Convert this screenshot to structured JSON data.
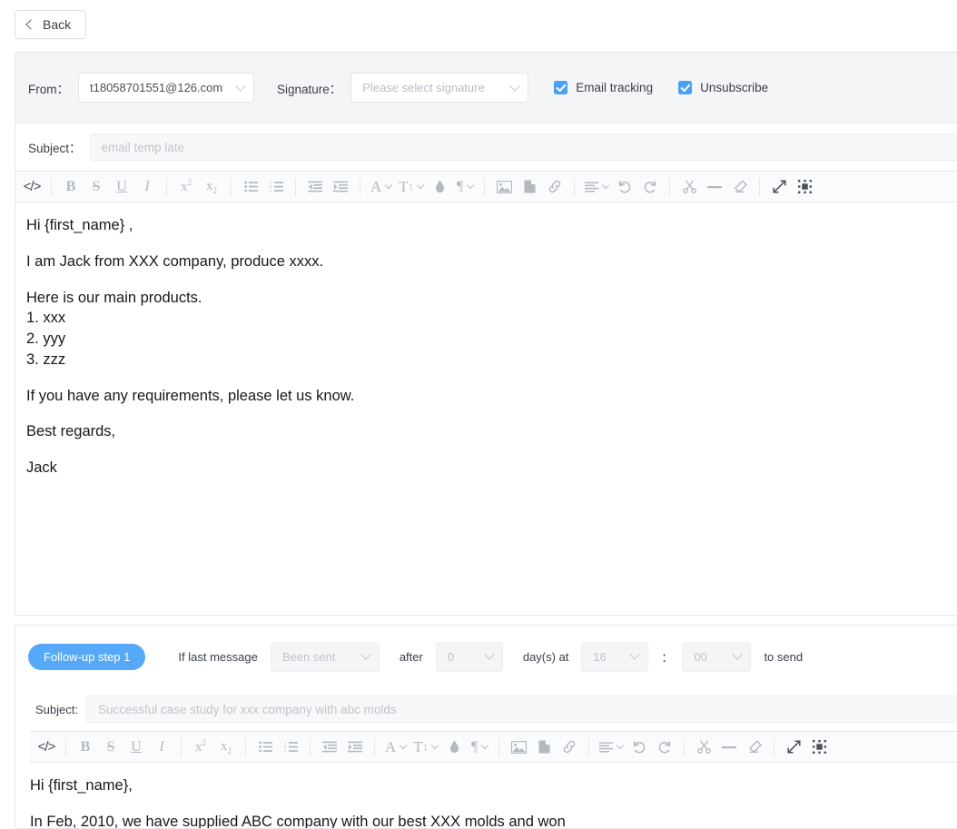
{
  "topbar": {
    "back_label": "Back",
    "back_icon": "chevron-left-icon"
  },
  "compose": {
    "from_label": "From：",
    "from_value": "t18058701551@126.com",
    "signature_label": "Signature：",
    "signature_value": "Please select signature",
    "email_tracking_label": "Email tracking",
    "email_tracking_checked": true,
    "unsubscribe_label": "Unsubscribe",
    "unsubscribe_checked": true,
    "subject_label": "Subject：",
    "subject_value": "",
    "subject_placeholder": "email temp late"
  },
  "toolbar": {
    "items": [
      {
        "name": "source-code-icon",
        "glyph": "</>",
        "kind": "code",
        "dark": true
      },
      {
        "name": "bold-icon",
        "glyph": "B",
        "kind": "bold"
      },
      {
        "name": "strikethrough-icon",
        "glyph": "S",
        "kind": "strike"
      },
      {
        "name": "underline-icon",
        "glyph": "U",
        "kind": "underline"
      },
      {
        "name": "italic-icon",
        "glyph": "I",
        "kind": "italic"
      },
      {
        "name": "superscript-icon",
        "glyph": "x2",
        "kind": "sup"
      },
      {
        "name": "subscript-icon",
        "glyph": "x2",
        "kind": "sub"
      },
      {
        "name": "bullet-list-icon",
        "glyph": "",
        "kind": "ul"
      },
      {
        "name": "numbered-list-icon",
        "glyph": "",
        "kind": "ol"
      },
      {
        "name": "outdent-icon",
        "glyph": "",
        "kind": "outdent"
      },
      {
        "name": "indent-icon",
        "glyph": "",
        "kind": "indent"
      },
      {
        "name": "font-color-icon",
        "glyph": "A",
        "kind": "fontcolor"
      },
      {
        "name": "font-size-icon",
        "glyph": "TI",
        "kind": "fontsize"
      },
      {
        "name": "background-color-icon",
        "glyph": "",
        "kind": "droplet"
      },
      {
        "name": "paragraph-format-icon",
        "glyph": "¶",
        "kind": "para"
      },
      {
        "name": "insert-image-icon",
        "glyph": "",
        "kind": "image"
      },
      {
        "name": "insert-file-icon",
        "glyph": "",
        "kind": "file"
      },
      {
        "name": "insert-link-icon",
        "glyph": "",
        "kind": "link"
      },
      {
        "name": "align-icon",
        "glyph": "",
        "kind": "align"
      },
      {
        "name": "undo-icon",
        "glyph": "",
        "kind": "undo"
      },
      {
        "name": "redo-icon",
        "glyph": "",
        "kind": "redo"
      },
      {
        "name": "cut-icon",
        "glyph": "",
        "kind": "cut"
      },
      {
        "name": "horizontal-rule-icon",
        "glyph": "",
        "kind": "hr"
      },
      {
        "name": "clear-formatting-icon",
        "glyph": "",
        "kind": "eraser"
      },
      {
        "name": "fullscreen-icon",
        "glyph": "",
        "kind": "fullscreen",
        "dark": true
      },
      {
        "name": "select-all-icon",
        "glyph": "",
        "kind": "selectall",
        "dark": true
      }
    ]
  },
  "body": {
    "greeting": "Hi {first_name} ,",
    "intro": "I am Jack from XXX company, produce xxxx.",
    "products_heading": "Here is our main products.",
    "products": [
      "1. xxx",
      "2. yyy",
      "3. zzz"
    ],
    "closing_request": "If you have any requirements, please let us know.",
    "signoff": "Best regards,",
    "sender": "Jack"
  },
  "followup": {
    "step_label": "Follow-up step 1",
    "condition_label": "If last message",
    "condition_value": "",
    "condition_placeholder": "Been sent",
    "after_label": "after",
    "days_value": "",
    "days_placeholder": "0",
    "days_label": "day(s) at",
    "hour_value": "",
    "hour_placeholder": "16",
    "time_separator": "：",
    "minute_value": "",
    "minute_placeholder": "00",
    "to_send_label": "to send",
    "subject_label": "Subject:",
    "subject_value": "",
    "subject_placeholder": "Successful case study for xxx company with abc molds",
    "body_greeting": "Hi {first_name},",
    "body_line1": "In Feb, 2010, we have supplied ABC company with our best XXX molds and won"
  },
  "colors": {
    "accent": "#56a9f8",
    "checkbox": "#49a1f5",
    "panel_bg": "#f4f5f7",
    "border": "#e6e8eb",
    "text": "#3b3f46",
    "placeholder": "#c0c4ca"
  }
}
